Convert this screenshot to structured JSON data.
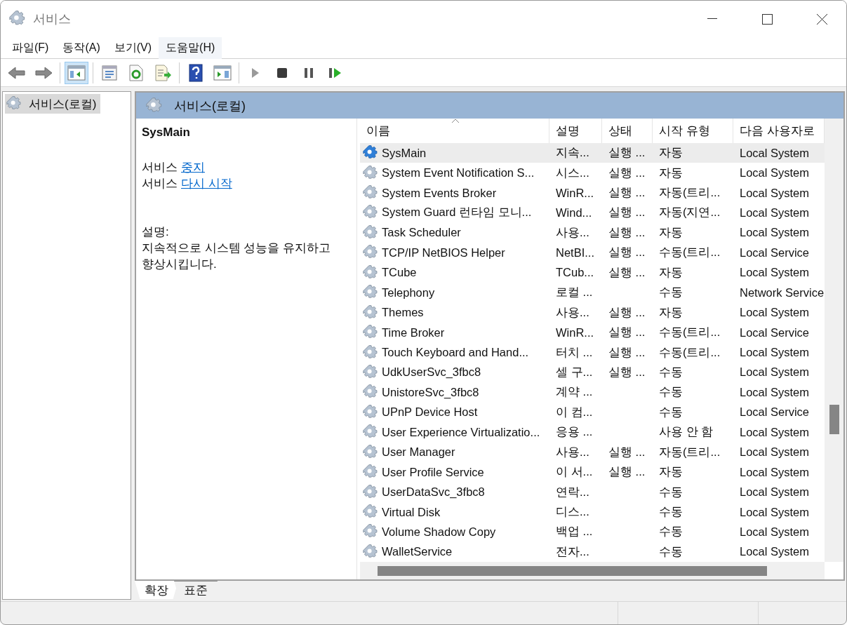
{
  "window": {
    "title": "서비스"
  },
  "menu": [
    {
      "label": "파일(F)",
      "highlighted": false
    },
    {
      "label": "동작(A)",
      "highlighted": false
    },
    {
      "label": "보기(V)",
      "highlighted": false
    },
    {
      "label": "도움말(H)",
      "highlighted": true
    }
  ],
  "toolbar": [
    {
      "kind": "back",
      "pressed": false
    },
    {
      "kind": "forward",
      "pressed": false
    },
    {
      "kind": "sep"
    },
    {
      "kind": "tree",
      "pressed": true
    },
    {
      "kind": "sep"
    },
    {
      "kind": "properties",
      "pressed": false
    },
    {
      "kind": "refresh",
      "pressed": false
    },
    {
      "kind": "export",
      "pressed": false
    },
    {
      "kind": "sep"
    },
    {
      "kind": "help",
      "pressed": false
    },
    {
      "kind": "actionpane",
      "pressed": false
    },
    {
      "kind": "sep"
    },
    {
      "kind": "play",
      "pressed": false
    },
    {
      "kind": "stop",
      "pressed": false
    },
    {
      "kind": "pause",
      "pressed": false
    },
    {
      "kind": "resume",
      "pressed": false
    }
  ],
  "tree": {
    "items": [
      {
        "label": "서비스(로컬)",
        "selected": true
      }
    ]
  },
  "panel": {
    "title": "서비스(로컬)"
  },
  "detail": {
    "title": "SysMain",
    "actions": [
      {
        "prefix": "서비스",
        "link": "중지"
      },
      {
        "prefix": "서비스",
        "link": "다시 시작"
      }
    ],
    "description_label": "설명:",
    "description": "지속적으로 시스템 성능을 유지하고 향상시킵니다."
  },
  "table": {
    "columns": [
      "이름",
      "설명",
      "상태",
      "시작 유형",
      "다음 사용자로"
    ],
    "rows": [
      {
        "name": "SysMain",
        "description": "지속...",
        "status": "실행 ...",
        "startup": "자동",
        "logon": "Local System",
        "selected": true
      },
      {
        "name": "System Event Notification S...",
        "description": "시스...",
        "status": "실행 ...",
        "startup": "자동",
        "logon": "Local System",
        "selected": false
      },
      {
        "name": "System Events Broker",
        "description": "WinR...",
        "status": "실행 ...",
        "startup": "자동(트리...",
        "logon": "Local System",
        "selected": false
      },
      {
        "name": "System Guard 런타임 모니...",
        "description": "Wind...",
        "status": "실행 ...",
        "startup": "자동(지연...",
        "logon": "Local System",
        "selected": false
      },
      {
        "name": "Task Scheduler",
        "description": "사용...",
        "status": "실행 ...",
        "startup": "자동",
        "logon": "Local System",
        "selected": false
      },
      {
        "name": "TCP/IP NetBIOS Helper",
        "description": "NetBI...",
        "status": "실행 ...",
        "startup": "수동(트리...",
        "logon": "Local Service",
        "selected": false
      },
      {
        "name": "TCube",
        "description": "TCub...",
        "status": "실행 ...",
        "startup": "자동",
        "logon": "Local System",
        "selected": false
      },
      {
        "name": "Telephony",
        "description": "로컬 ...",
        "status": "",
        "startup": "수동",
        "logon": "Network Service",
        "selected": false
      },
      {
        "name": "Themes",
        "description": "사용...",
        "status": "실행 ...",
        "startup": "자동",
        "logon": "Local System",
        "selected": false
      },
      {
        "name": "Time Broker",
        "description": "WinR...",
        "status": "실행 ...",
        "startup": "수동(트리...",
        "logon": "Local Service",
        "selected": false
      },
      {
        "name": "Touch Keyboard and Hand...",
        "description": "터치 ...",
        "status": "실행 ...",
        "startup": "수동(트리...",
        "logon": "Local System",
        "selected": false
      },
      {
        "name": "UdkUserSvc_3fbc8",
        "description": "셀 구...",
        "status": "실행 ...",
        "startup": "수동",
        "logon": "Local System",
        "selected": false
      },
      {
        "name": "UnistoreSvc_3fbc8",
        "description": "계약 ...",
        "status": "",
        "startup": "수동",
        "logon": "Local System",
        "selected": false
      },
      {
        "name": "UPnP Device Host",
        "description": "이 컴...",
        "status": "",
        "startup": "수동",
        "logon": "Local Service",
        "selected": false
      },
      {
        "name": "User Experience Virtualizatio...",
        "description": "응용 ...",
        "status": "",
        "startup": "사용 안 함",
        "logon": "Local System",
        "selected": false
      },
      {
        "name": "User Manager",
        "description": "사용...",
        "status": "실행 ...",
        "startup": "자동(트리...",
        "logon": "Local System",
        "selected": false
      },
      {
        "name": "User Profile Service",
        "description": "이 서...",
        "status": "실행 ...",
        "startup": "자동",
        "logon": "Local System",
        "selected": false
      },
      {
        "name": "UserDataSvc_3fbc8",
        "description": "연락...",
        "status": "",
        "startup": "수동",
        "logon": "Local System",
        "selected": false
      },
      {
        "name": "Virtual Disk",
        "description": "디스...",
        "status": "",
        "startup": "수동",
        "logon": "Local System",
        "selected": false
      },
      {
        "name": "Volume Shadow Copy",
        "description": "백업 ...",
        "status": "",
        "startup": "수동",
        "logon": "Local System",
        "selected": false
      },
      {
        "name": "WalletService",
        "description": "전자...",
        "status": "",
        "startup": "수동",
        "logon": "Local System",
        "selected": false
      }
    ]
  },
  "view_tabs": [
    {
      "label": "확장",
      "selected": true
    },
    {
      "label": "표준",
      "selected": false
    }
  ]
}
